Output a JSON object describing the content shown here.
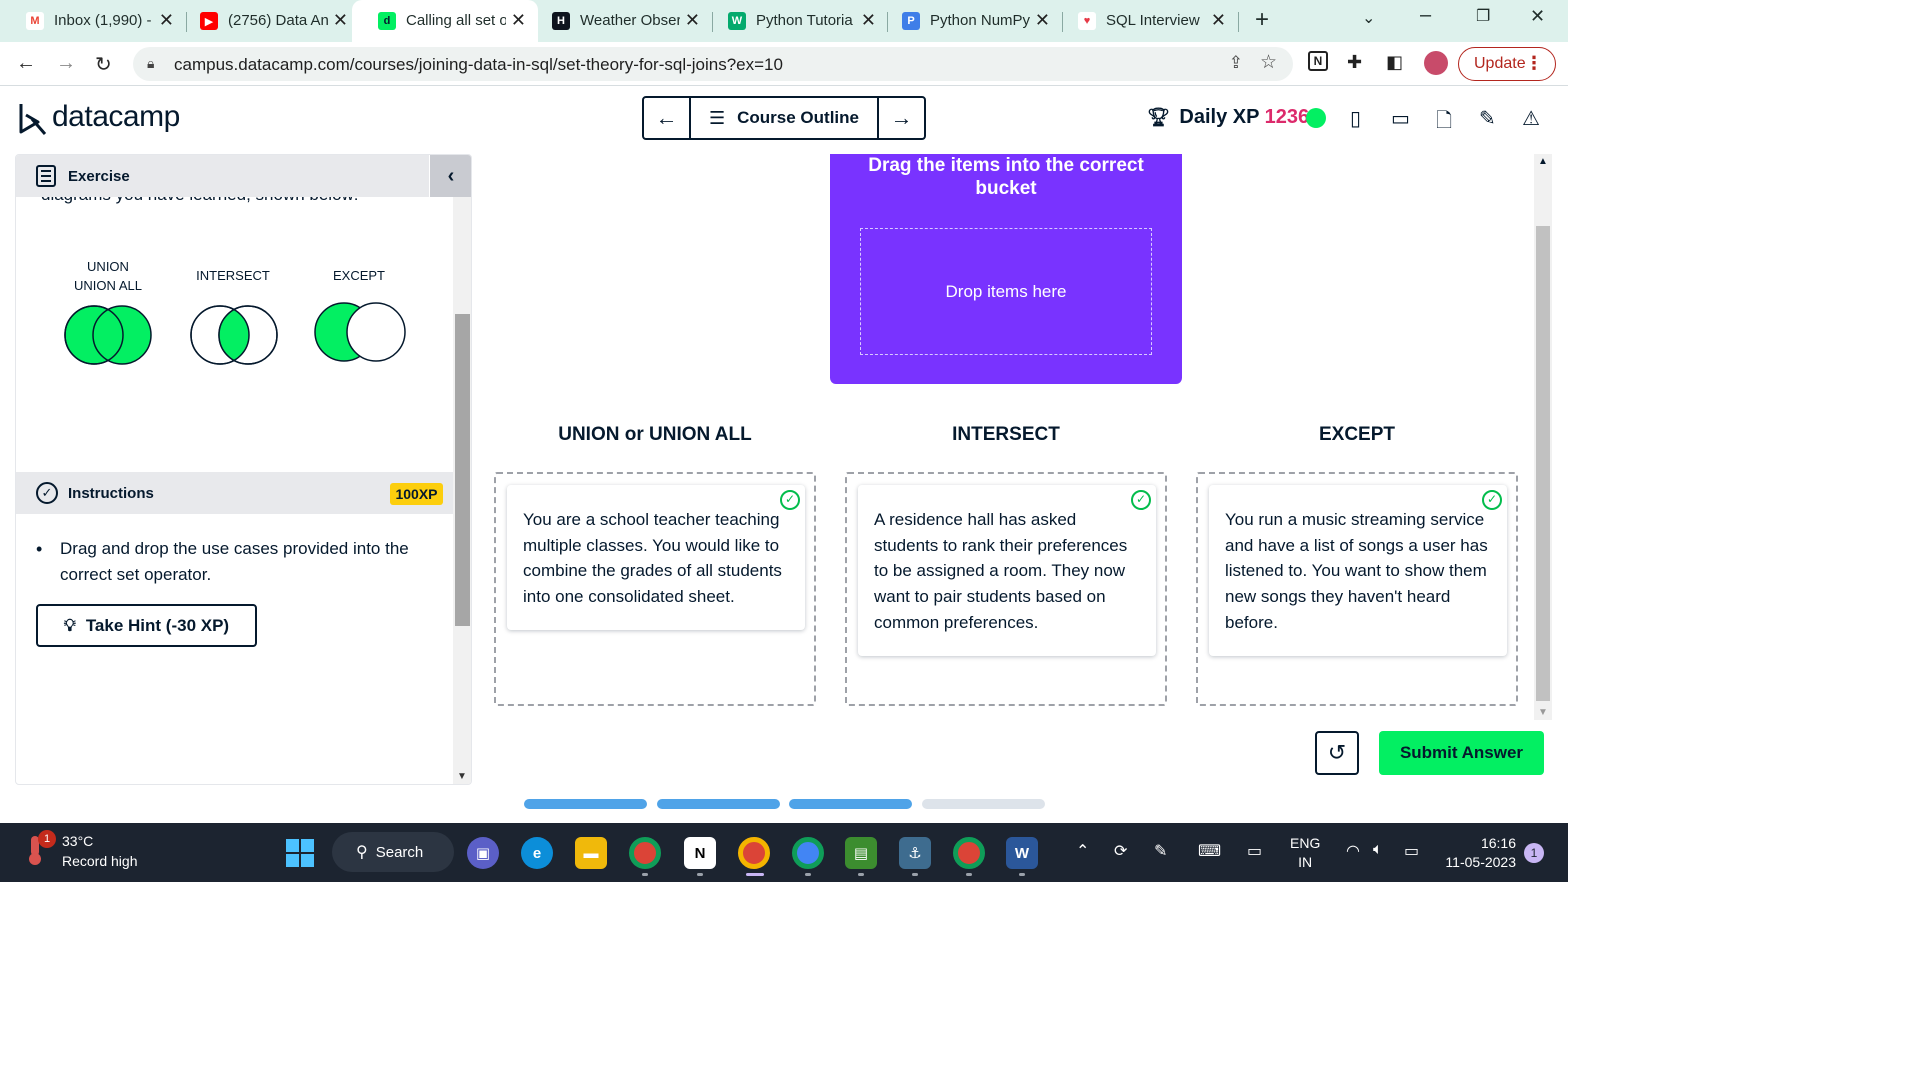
{
  "browser": {
    "tabs": [
      {
        "title": "Inbox (1,990) -",
        "favicon": "gmail-icon",
        "color": "#ea4335",
        "glyph": "M"
      },
      {
        "title": "(2756) Data An",
        "favicon": "youtube-icon",
        "color": "#ff0000",
        "glyph": "▶"
      },
      {
        "title": "Calling all set o",
        "favicon": "datacamp-icon",
        "color": "#03ef62",
        "glyph": "d",
        "active": true
      },
      {
        "title": "Weather Obser",
        "favicon": "hackerrank-icon",
        "color": "#0e141e",
        "glyph": "H"
      },
      {
        "title": "Python Tutoria",
        "favicon": "w3schools-icon",
        "color": "#04aa6d",
        "glyph": "W"
      },
      {
        "title": "Python NumPy",
        "favicon": "programiz-icon",
        "color": "#3f7ee8",
        "glyph": "P"
      },
      {
        "title": "SQL Interview",
        "favicon": "interviewquery-icon",
        "color": "#e63946",
        "glyph": "♥"
      }
    ],
    "url": "campus.datacamp.com/courses/joining-data-in-sql/set-theory-for-sql-joins?ex=10",
    "update_label": "Update"
  },
  "header": {
    "logo_text": "datacamp",
    "course_outline_label": "Course Outline",
    "xp_label": "Daily XP",
    "xp_value": "1236"
  },
  "left_panel": {
    "exercise_label": "Exercise",
    "cut_text": "diagrams you have learned, shown below:",
    "venn": [
      {
        "label_line1": "UNION",
        "label_line2": "UNION ALL"
      },
      {
        "label_line1": "INTERSECT",
        "label_line2": ""
      },
      {
        "label_line1": "EXCEPT",
        "label_line2": ""
      }
    ],
    "instructions_label": "Instructions",
    "xp_badge": "100XP",
    "instruction_text": "Drag and drop the use cases provided into the correct set operator.",
    "hint_label": "Take Hint (-30 XP)"
  },
  "main": {
    "bucket_title": "Drag the items into the correct bucket",
    "drop_placeholder": "Drop items here",
    "columns": [
      {
        "title": "UNION or UNION ALL",
        "card": "You are a school teacher teaching multiple classes. You would like to combine the grades of all students into one consolidated sheet."
      },
      {
        "title": "INTERSECT",
        "card": "A residence hall has asked students to rank their preferences to be assigned a room. They now want to pair students based on common preferences."
      },
      {
        "title": "EXCEPT",
        "card": "You run a music streaming service and have a list of songs a user has listened to. You want to show them new songs they haven't heard before."
      }
    ],
    "submit_label": "Submit Answer",
    "progress": {
      "completed": 3,
      "total": 4
    }
  },
  "colors": {
    "accent_green": "#03ef62",
    "purple": "#7933ff",
    "navy": "#05192d",
    "xp_pink": "#dc2a6b",
    "progress_done": "#4fa3e8",
    "progress_todo": "#dde3ea"
  },
  "taskbar": {
    "weather_temp": "33°C",
    "weather_desc": "Record high",
    "weather_badge": "1",
    "search_label": "Search",
    "lang_line1": "ENG",
    "lang_line2": "IN",
    "time": "16:16",
    "date": "11-05-2023",
    "notifications": "1"
  }
}
